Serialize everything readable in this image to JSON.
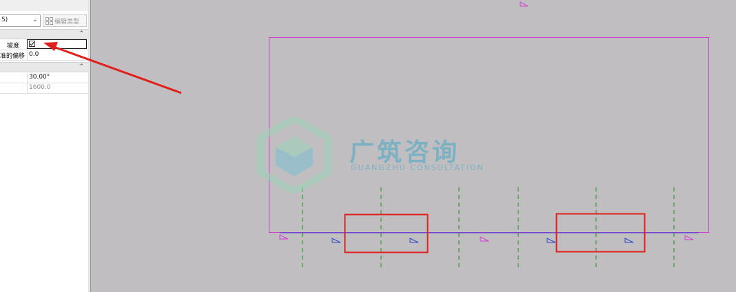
{
  "panel": {
    "type_selector_text": "5)",
    "edit_type_label": "编辑类型",
    "sections": [
      {
        "rows": [
          {
            "label": "坡度",
            "checked": true
          },
          {
            "label": "准的偏移",
            "value": "0.0"
          }
        ]
      },
      {
        "rows": [
          {
            "label": "",
            "value": "30.00°"
          },
          {
            "label": "",
            "value": "1600.0",
            "muted": true
          }
        ]
      }
    ]
  },
  "watermark": {
    "title": "广筑咨询",
    "subtitle": "GUANGZHU CONSULTATION"
  },
  "colors": {
    "canvas_bg": "#c0bec0",
    "boundary_magenta": "#d23ad2",
    "grid_green": "#1e8c1e",
    "footprint_blue": "#2a45c8",
    "highlight_red": "#e0201c"
  }
}
